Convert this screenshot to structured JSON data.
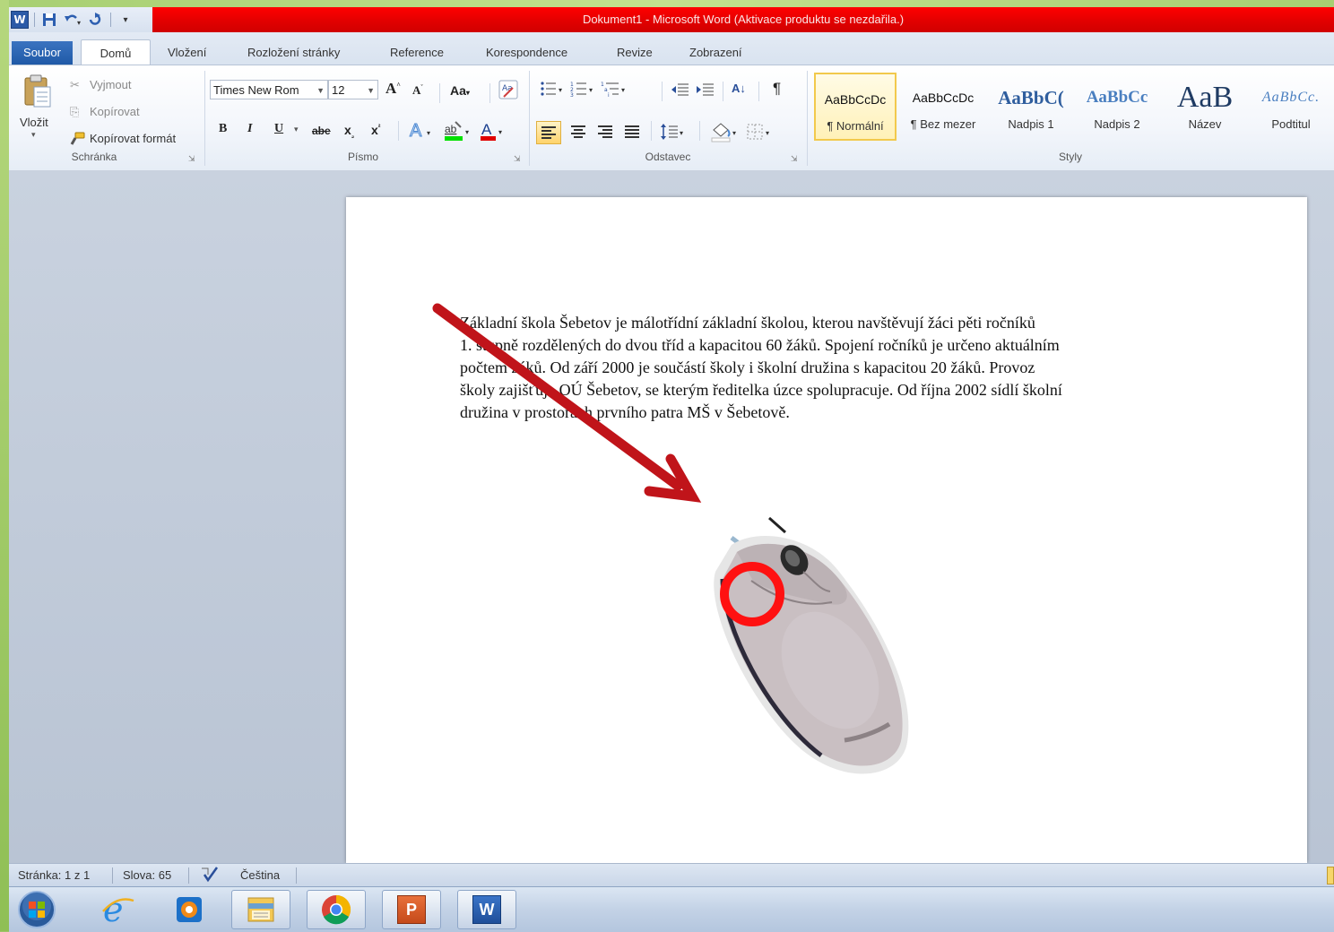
{
  "window": {
    "title": "Dokument1  -  Microsoft Word (Aktivace produktu se nezdařila.)"
  },
  "qat": {
    "icons": [
      "word-logo-icon",
      "save-icon",
      "undo-icon",
      "redo-icon",
      "customize-qat-icon"
    ],
    "word_logo_letter": "W"
  },
  "tabs": {
    "file": "Soubor",
    "items": [
      "Domů",
      "Vložení",
      "Rozložení stránky",
      "Reference",
      "Korespondence",
      "Revize",
      "Zobrazení"
    ]
  },
  "clipboard": {
    "group": "Schránka",
    "paste": "Vložit",
    "cut": "Vyjmout",
    "copy": "Kopírovat",
    "format_painter": "Kopírovat formát"
  },
  "font": {
    "group": "Písmo",
    "family": "Times New Rom",
    "size": "12",
    "grow": "A",
    "shrink": "A",
    "change_case": "Aa",
    "bold": "B",
    "italic": "I",
    "underline": "U",
    "strike": "abe",
    "subscript": "x",
    "superscript": "x",
    "font_color": "A",
    "highlight": "ab"
  },
  "paragraph": {
    "group": "Odstavec",
    "sort": "A↓",
    "pilcrow": "¶"
  },
  "styles": {
    "group": "Styly",
    "items": [
      {
        "preview": "AaBbCcDc",
        "name": "¶ Normální",
        "selected": true
      },
      {
        "preview": "AaBbCcDc",
        "name": "¶ Bez mezer",
        "selected": false
      },
      {
        "preview": "AaBbC(",
        "name": "Nadpis 1",
        "selected": false
      },
      {
        "preview": "AaBbCc",
        "name": "Nadpis 2",
        "selected": false
      },
      {
        "preview": "AaB",
        "name": "Název",
        "selected": false
      },
      {
        "preview": "AaBbCc.",
        "name": "Podtitul",
        "selected": false
      }
    ]
  },
  "document": {
    "lines": [
      "Základní škola  Šebetov  je málotřídní základní školou, kterou navštěvují žáci pěti ročníků",
      "1. stupně rozdělených do dvou tříd a kapacitou 60 žáků. Spojení ročníků je určeno aktuálním",
      "počtem žáků. Od září 2000 je součástí školy i školní družina s kapacitou 20 žáků. Provoz",
      "školy zajišťuje OÚ Šebetov, se kterým ředitelka úzce spolupracuje.  Od října 2002 sídlí školní",
      "družina v prostorách prvního patra MŠ v Šebetově."
    ]
  },
  "status": {
    "page": "Stránka: 1 z 1",
    "words": "Slova: 65",
    "language": "Čeština"
  },
  "taskbar": {
    "items": [
      "start-orb-icon",
      "internet-explorer-icon",
      "media-player-icon",
      "explorer-icon",
      "chrome-icon",
      "powerpoint-icon",
      "word-icon"
    ],
    "powerpoint_letter": "P",
    "word_letter": "W"
  },
  "colors": {
    "title_red": "#e00000",
    "arrow": "#c0141a",
    "highlight_circle": "#ff1111",
    "file_tab": "#2a62b2"
  }
}
